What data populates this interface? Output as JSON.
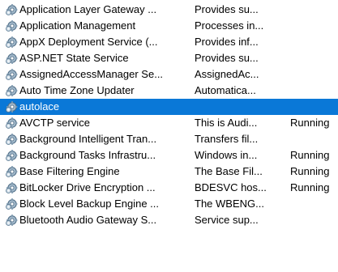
{
  "services": [
    {
      "name": "Application Layer Gateway ...",
      "description": "Provides su...",
      "status": "",
      "icon": "service-gear-icon"
    },
    {
      "name": "Application Management",
      "description": "Processes in...",
      "status": "",
      "icon": "service-gear-icon"
    },
    {
      "name": "AppX Deployment Service (...",
      "description": "Provides inf...",
      "status": "",
      "icon": "service-gear-icon"
    },
    {
      "name": "ASP.NET State Service",
      "description": "Provides su...",
      "status": "",
      "icon": "service-gear-icon"
    },
    {
      "name": "AssignedAccessManager Se...",
      "description": "AssignedAc...",
      "status": "",
      "icon": "service-gear-icon"
    },
    {
      "name": "Auto Time Zone Updater",
      "description": "Automatica...",
      "status": "",
      "icon": "service-gear-icon"
    },
    {
      "name": "autolace",
      "description": "",
      "status": "",
      "icon": "service-gear-icon",
      "selected": true
    },
    {
      "name": "AVCTP service",
      "description": "This is Audi...",
      "status": "Running",
      "icon": "service-gear-icon"
    },
    {
      "name": "Background Intelligent Tran...",
      "description": "Transfers fil...",
      "status": "",
      "icon": "service-gear-icon"
    },
    {
      "name": "Background Tasks Infrastru...",
      "description": "Windows in...",
      "status": "Running",
      "icon": "service-gear-icon"
    },
    {
      "name": "Base Filtering Engine",
      "description": "The Base Fil...",
      "status": "Running",
      "icon": "service-gear-icon"
    },
    {
      "name": "BitLocker Drive Encryption ...",
      "description": "BDESVC hos...",
      "status": "Running",
      "icon": "service-gear-icon"
    },
    {
      "name": "Block Level Backup Engine ...",
      "description": "The WBENG...",
      "status": "",
      "icon": "service-gear-icon"
    },
    {
      "name": "Bluetooth Audio Gateway S...",
      "description": "Service sup...",
      "status": "",
      "icon": "service-gear-icon"
    }
  ],
  "colors": {
    "selection": "#0a78d7"
  }
}
